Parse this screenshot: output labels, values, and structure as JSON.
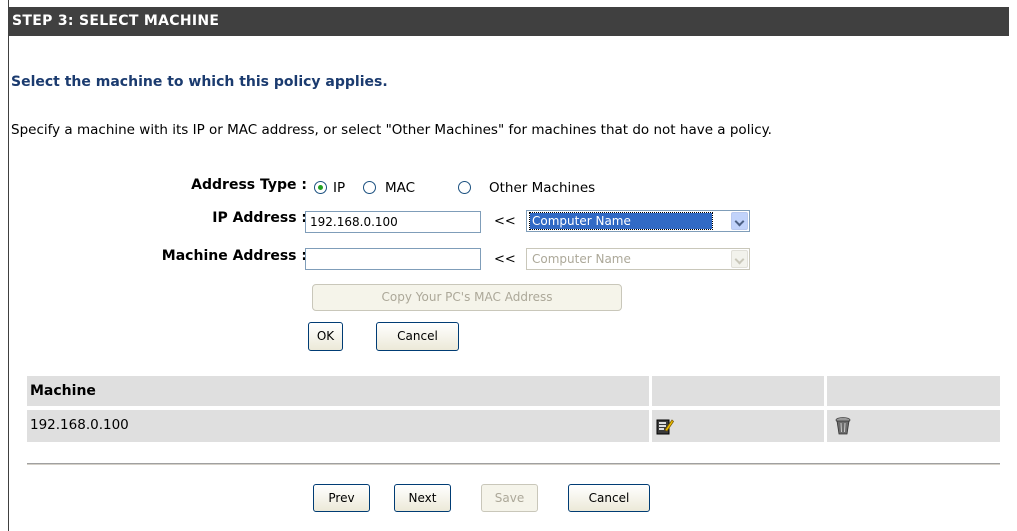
{
  "header": {
    "title": "STEP 3: SELECT MACHINE"
  },
  "subtitle": "Select the machine to which this policy applies.",
  "description": "Specify a machine with its IP or MAC address, or select \"Other Machines\" for machines that do not have a policy.",
  "form": {
    "address_type_label": "Address Type :",
    "address_type_options": [
      "IP",
      "MAC",
      "Other Machines"
    ],
    "address_type_selected": "IP",
    "ip_label": "IP Address :",
    "ip_value": "192.168.0.100",
    "ip_arrow": "<<",
    "ip_select_value": "Computer Name",
    "machine_label": "Machine Address :",
    "machine_value": "",
    "machine_arrow": "<<",
    "machine_select_value": "Computer Name",
    "copy_mac_label": "Copy Your PC's MAC Address",
    "ok_label": "OK",
    "cancel_label": "Cancel"
  },
  "table": {
    "columns": [
      "Machine",
      "",
      ""
    ],
    "rows": [
      {
        "machine": "192.168.0.100",
        "edit_icon": "edit-icon",
        "delete_icon": "trash-icon"
      }
    ]
  },
  "footer": {
    "prev_label": "Prev",
    "next_label": "Next",
    "save_label": "Save",
    "cancel_label": "Cancel"
  },
  "colors": {
    "header_bg": "#404040",
    "subtitle": "#1b3b6f",
    "table_bg": "#dfdfdf",
    "selection": "#316ac5"
  }
}
